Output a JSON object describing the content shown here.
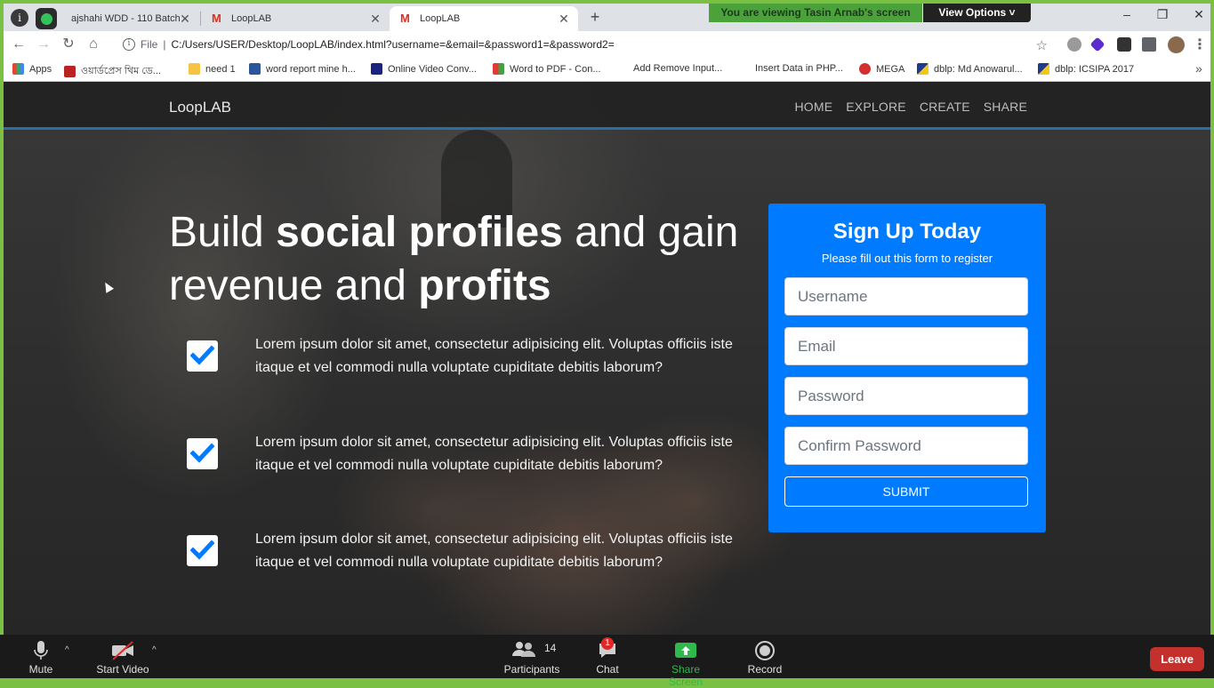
{
  "browser": {
    "tabs": [
      {
        "title": "ajshahi WDD - 110 Batch",
        "active": false
      },
      {
        "title": "LoopLAB",
        "active": false
      },
      {
        "title": "LoopLAB",
        "active": true
      }
    ],
    "url": "C:/Users/USER/Desktop/LoopLAB/index.html?username=&email=&password1=&password2=",
    "url_prefix": "File",
    "bookmarks": [
      {
        "label": "Apps"
      },
      {
        "label": "ওয়ার্ডপ্রেস থিম ডে..."
      },
      {
        "label": "need 1"
      },
      {
        "label": "word report mine h..."
      },
      {
        "label": "Online Video Conv..."
      },
      {
        "label": "Word to PDF - Con..."
      },
      {
        "label": "Add Remove Input..."
      },
      {
        "label": "Insert Data in PHP..."
      },
      {
        "label": "MEGA"
      },
      {
        "label": "dblp: Md Anowarul..."
      },
      {
        "label": "dblp: ICSIPA 2017"
      }
    ]
  },
  "zoom": {
    "banner": "You are viewing Tasin Arnab's screen",
    "view_options": "View Options",
    "toolbar": {
      "mute": "Mute",
      "start_video": "Start Video",
      "participants": "Participants",
      "participants_count": "14",
      "chat": "Chat",
      "chat_badge": "1",
      "share_screen": "Share Screen",
      "record": "Record",
      "leave": "Leave"
    }
  },
  "site": {
    "brand": "LoopLAB",
    "nav": [
      "HOME",
      "EXPLORE",
      "CREATE",
      "SHARE"
    ],
    "headline": {
      "p1": "Build ",
      "b1": "social profiles",
      "p2": " and gain revenue and ",
      "b2": "profits"
    },
    "features": [
      "Lorem ipsum dolor sit amet, consectetur adipisicing elit. Voluptas officiis iste itaque et vel commodi nulla voluptate cupiditate debitis laborum?",
      "Lorem ipsum dolor sit amet, consectetur adipisicing elit. Voluptas officiis iste itaque et vel commodi nulla voluptate cupiditate debitis laborum?",
      "Lorem ipsum dolor sit amet, consectetur adipisicing elit. Voluptas officiis iste itaque et vel commodi nulla voluptate cupiditate debitis laborum?"
    ],
    "signup": {
      "title": "Sign Up Today",
      "subtitle": "Please fill out this form to register",
      "username_placeholder": "Username",
      "email_placeholder": "Email",
      "password_placeholder": "Password",
      "confirm_placeholder": "Confirm Password",
      "submit": "SUBMIT"
    }
  },
  "colors": {
    "zoom_border": "#7ac143",
    "form_bg": "#007bff",
    "leave_bg": "#c4312c"
  }
}
